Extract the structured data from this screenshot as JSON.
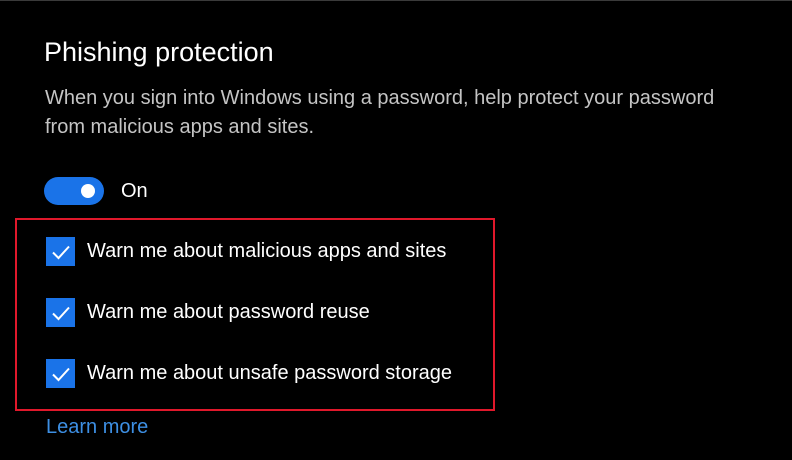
{
  "section": {
    "title": "Phishing protection",
    "description": "When you sign into Windows using a password, help protect your password from malicious apps and sites."
  },
  "toggle": {
    "state": "On",
    "on": true,
    "color": "#1a73e8"
  },
  "options": [
    {
      "label": "Warn me about malicious apps and sites",
      "checked": true,
      "icon": "checkmark-icon"
    },
    {
      "label": "Warn me about password reuse",
      "checked": true,
      "icon": "checkmark-icon"
    },
    {
      "label": "Warn me about unsafe password storage",
      "checked": true,
      "icon": "checkmark-icon"
    }
  ],
  "link": {
    "label": "Learn more"
  },
  "colors": {
    "background": "#000000",
    "accent": "#1a73e8",
    "link": "#3d8fe3",
    "highlight_border": "#e0182b",
    "description_text": "#c4c4c4"
  }
}
